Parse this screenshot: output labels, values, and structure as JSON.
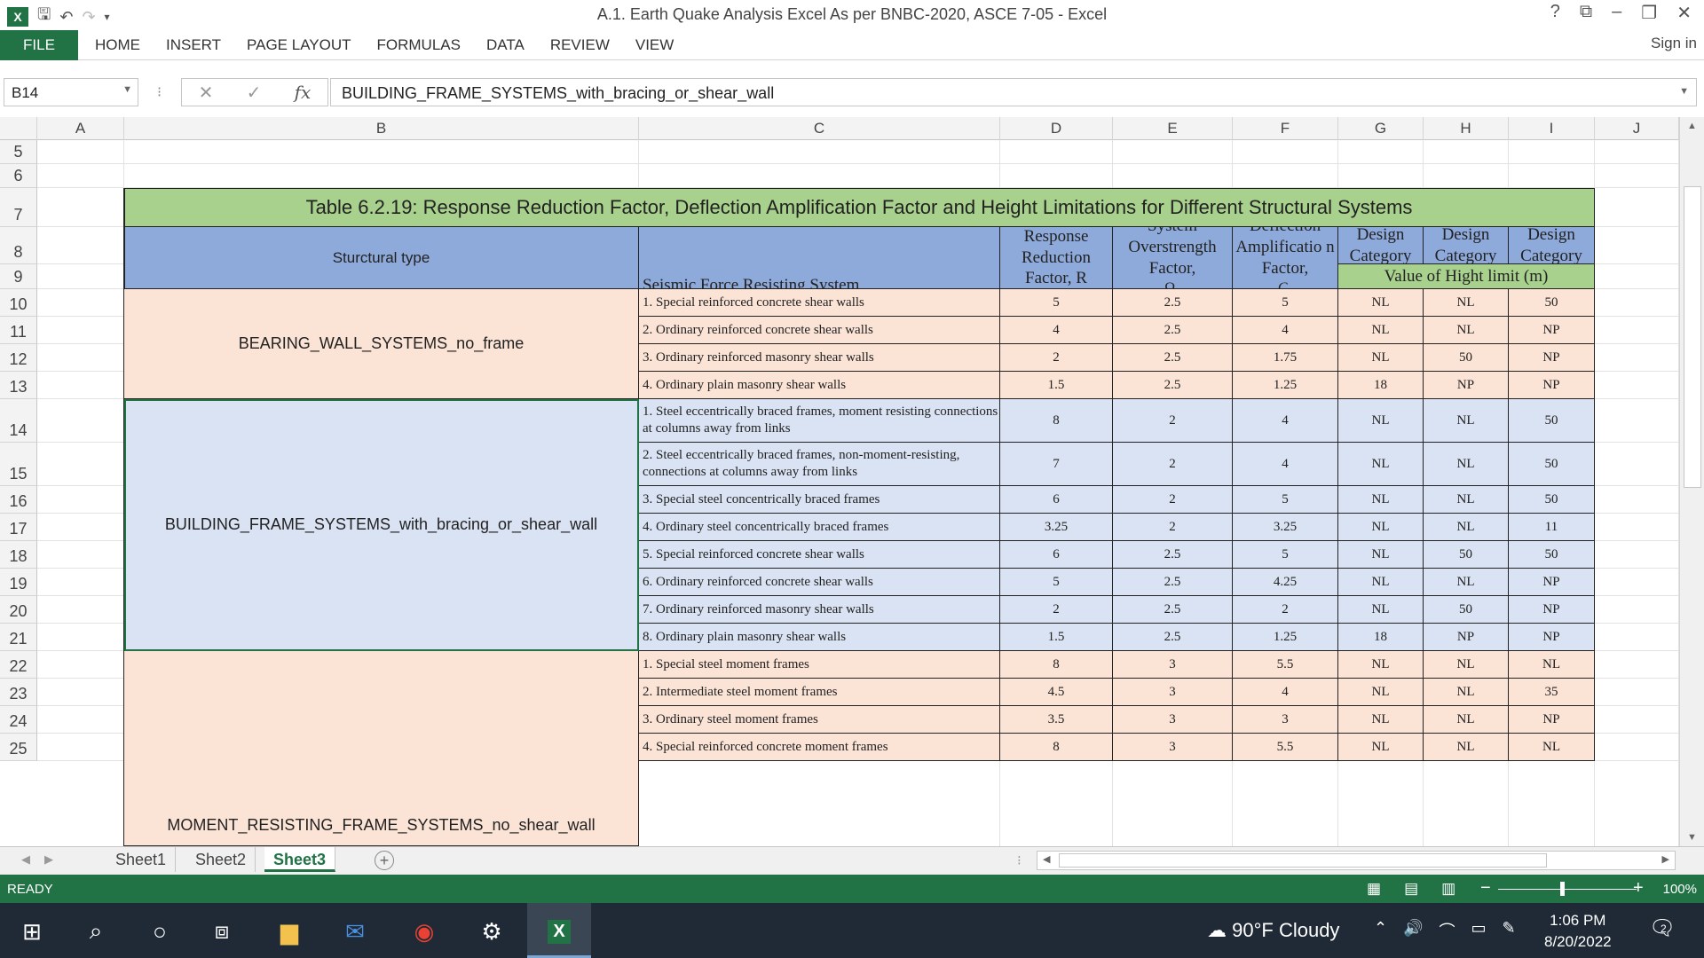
{
  "window": {
    "title": "A.1. Earth Quake Analysis Excel As per BNBC-2020, ASCE 7-05 - Excel",
    "help": "?",
    "sign_in": "Sign in"
  },
  "ribbon": {
    "file": "FILE",
    "tabs": [
      "HOME",
      "INSERT",
      "PAGE LAYOUT",
      "FORMULAS",
      "DATA",
      "REVIEW",
      "VIEW"
    ]
  },
  "formula_bar": {
    "name_box": "B14",
    "fx": "fx",
    "content": "BUILDING_FRAME_SYSTEMS_with_bracing_or_shear_wall"
  },
  "columns": [
    "A",
    "B",
    "C",
    "D",
    "E",
    "F",
    "G",
    "H",
    "I",
    "J"
  ],
  "rows": [
    "5",
    "6",
    "7",
    "8",
    "9",
    "10",
    "11",
    "12",
    "13",
    "14",
    "15",
    "16",
    "17",
    "18",
    "19",
    "20",
    "21",
    "22",
    "23",
    "24",
    "25"
  ],
  "table": {
    "title": "Table 6.2.19: Response Reduction Factor, Deflection Amplification Factor and Height Limitations for Different Structural Systems",
    "headers": {
      "structural_type": "Sturctural type",
      "system": "Seismic Force Resisting System",
      "r": "Response Reduction Factor, R",
      "omega": "System Overstrength Factor,",
      "omega_sym": "Ω",
      "omega_sub": "o",
      "cd": "Deflection Amplificatio n Factor,",
      "cd_sym": "C",
      "cd_sub": "d",
      "sdc_b": "Seismic Design Category (B)",
      "sdc_c": "Seismic Design Category (C)",
      "sdc_d": "Seismic Design Category (D)",
      "height_limit": "Value of Hight limit (m)"
    },
    "groups": [
      "BEARING_WALL_SYSTEMS_no_frame",
      "BUILDING_FRAME_SYSTEMS_with_bracing_or_shear_wall",
      "MOMENT_RESISTING_FRAME_SYSTEMS_no_shear_wall"
    ],
    "data": [
      [
        "1. Special reinforced concrete shear walls",
        "5",
        "2.5",
        "5",
        "NL",
        "NL",
        "50"
      ],
      [
        "2. Ordinary reinforced concrete shear walls",
        "4",
        "2.5",
        "4",
        "NL",
        "NL",
        "NP"
      ],
      [
        "3. Ordinary reinforced masonry shear walls",
        "2",
        "2.5",
        "1.75",
        "NL",
        "50",
        "NP"
      ],
      [
        "4. Ordinary plain masonry shear walls",
        "1.5",
        "2.5",
        "1.25",
        "18",
        "NP",
        "NP"
      ],
      [
        "1. Steel eccentrically braced frames, moment resisting connections at columns away from links",
        "8",
        "2",
        "4",
        "NL",
        "NL",
        "50"
      ],
      [
        "2. Steel eccentrically braced frames, non-moment-resisting, connections at columns away from links",
        "7",
        "2",
        "4",
        "NL",
        "NL",
        "50"
      ],
      [
        "3. Special steel concentrically braced frames",
        "6",
        "2",
        "5",
        "NL",
        "NL",
        "50"
      ],
      [
        "4. Ordinary steel concentrically braced frames",
        "3.25",
        "2",
        "3.25",
        "NL",
        "NL",
        "11"
      ],
      [
        "5. Special reinforced concrete shear walls",
        "6",
        "2.5",
        "5",
        "NL",
        "50",
        "50"
      ],
      [
        "6. Ordinary reinforced concrete shear walls",
        "5",
        "2.5",
        "4.25",
        "NL",
        "NL",
        "NP"
      ],
      [
        "7. Ordinary reinforced masonry shear walls",
        "2",
        "2.5",
        "2",
        "NL",
        "50",
        "NP"
      ],
      [
        "8. Ordinary plain masonry shear walls",
        "1.5",
        "2.5",
        "1.25",
        "18",
        "NP",
        "NP"
      ],
      [
        "1. Special steel moment frames",
        "8",
        "3",
        "5.5",
        "NL",
        "NL",
        "NL"
      ],
      [
        "2. Intermediate steel moment frames",
        "4.5",
        "3",
        "4",
        "NL",
        "NL",
        "35"
      ],
      [
        "3. Ordinary steel moment frames",
        "3.5",
        "3",
        "3",
        "NL",
        "NL",
        "NP"
      ],
      [
        "4. Special reinforced concrete moment frames",
        "8",
        "3",
        "5.5",
        "NL",
        "NL",
        "NL"
      ]
    ]
  },
  "sheets": {
    "tabs": [
      "Sheet1",
      "Sheet2",
      "Sheet3"
    ],
    "active": "Sheet3"
  },
  "status": {
    "ready": "READY",
    "zoom": "100%",
    "zoom_level_percent": 100
  },
  "taskbar": {
    "weather": "90°F Cloudy",
    "time": "1:06 PM",
    "date": "8/20/2022",
    "notifications": "2"
  },
  "colors": {
    "excel_green": "#217346",
    "title_green": "#a9d18e",
    "header_blue": "#8eaadb",
    "peach": "#fbe3d6",
    "light_blue": "#dae3f3"
  }
}
